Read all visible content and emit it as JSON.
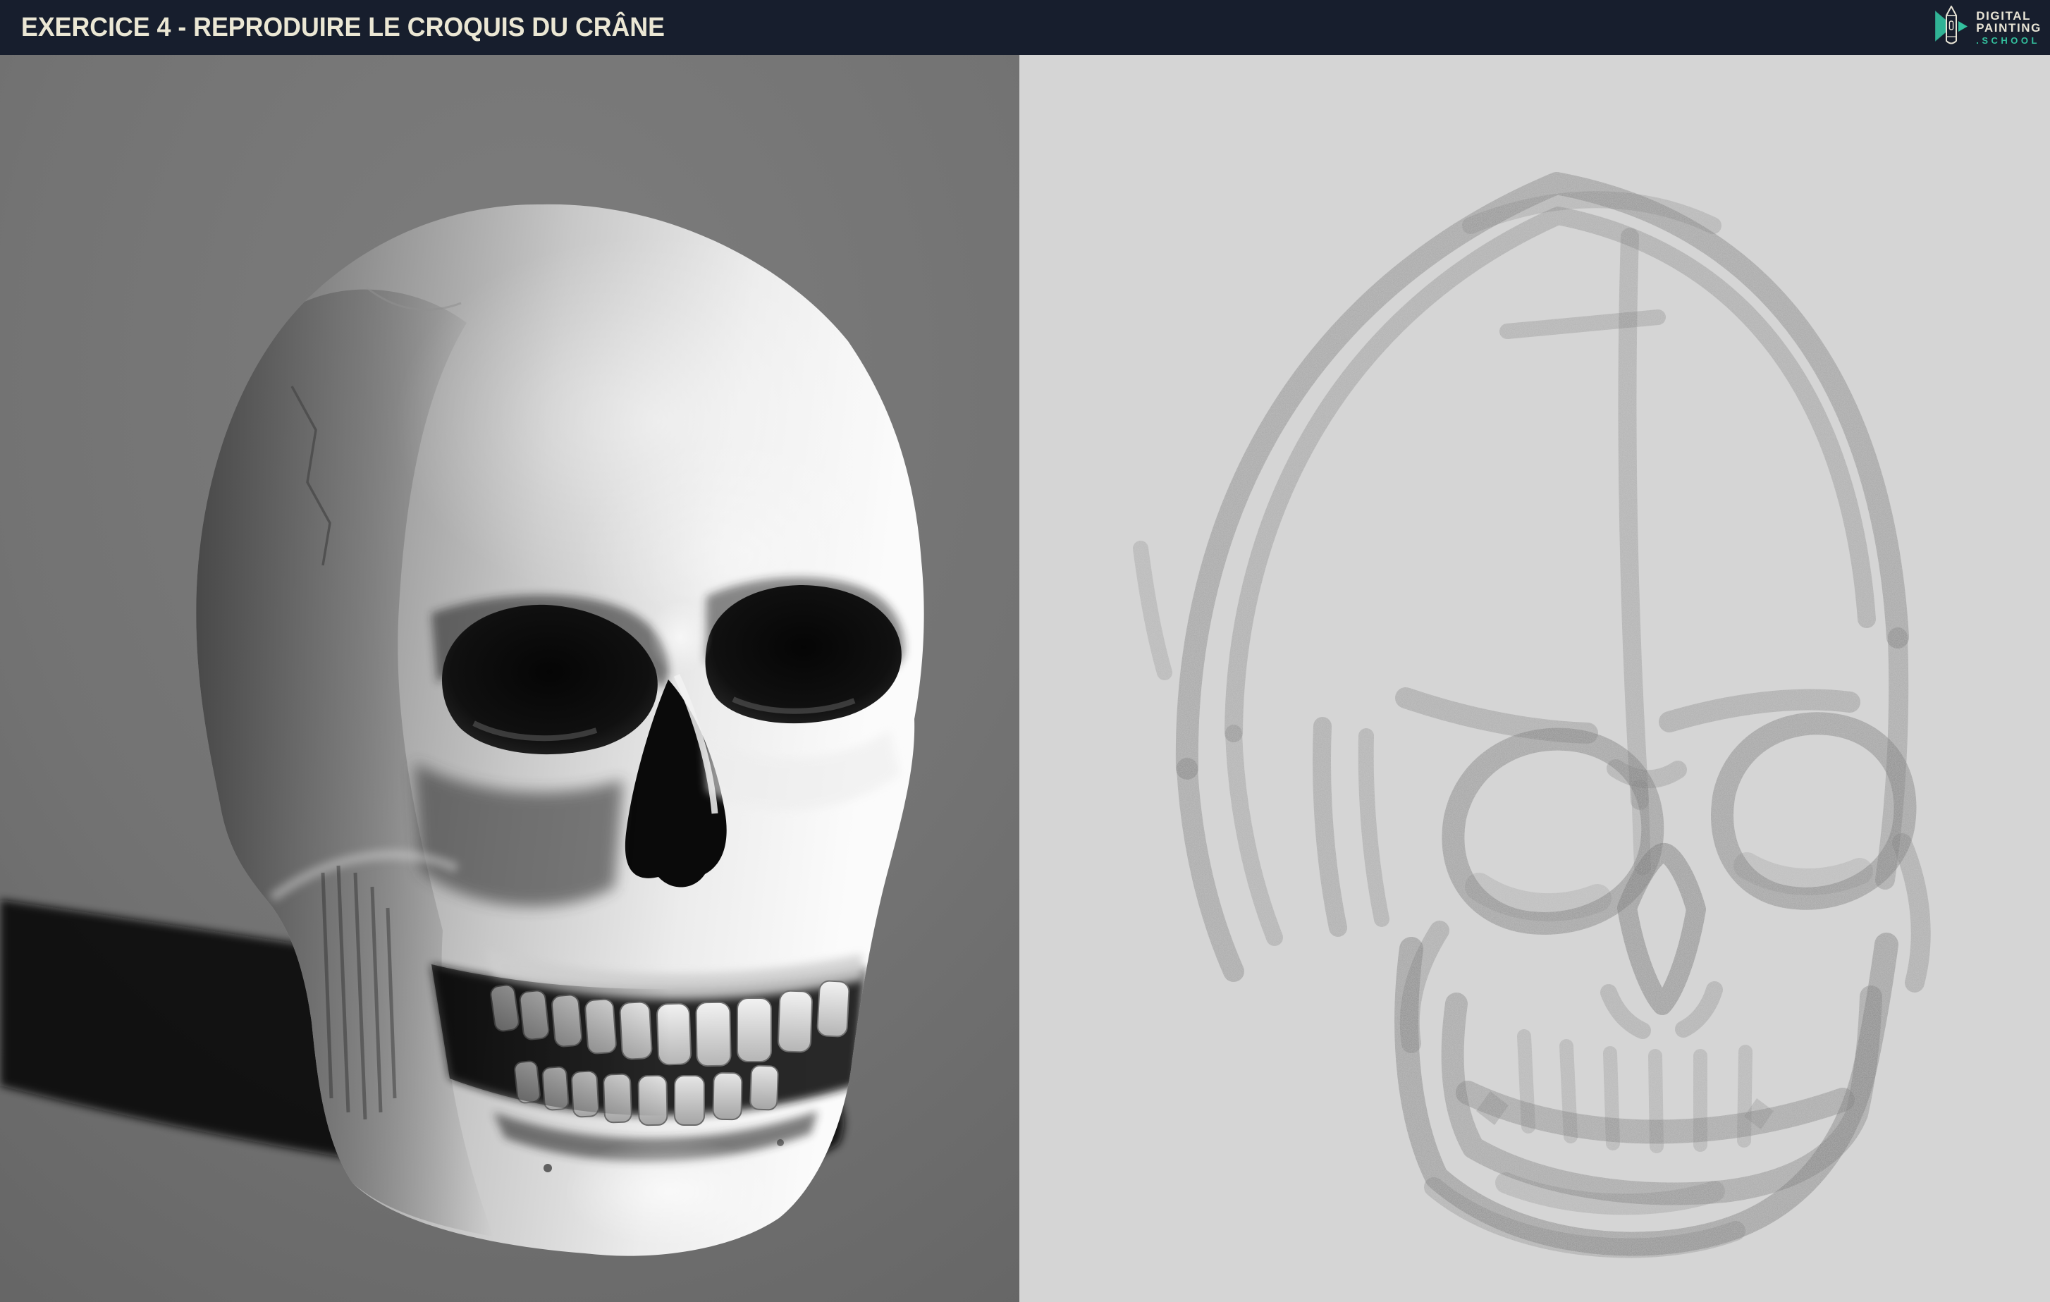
{
  "header": {
    "title": "EXERCICE 4 - REPRODUIRE LE CROQUIS DU CRÂNE",
    "logo": {
      "line1": "DIGITAL",
      "line2": "PAINTING",
      "line3": ".SCHOOL"
    }
  },
  "colors": {
    "header_bg": "#171e2d",
    "header_title_text": "#ebe7d4",
    "logo_text": "#e9e5d6",
    "logo_accent_teal": "#33c09e",
    "render_background": "#747474",
    "render_cast_shadow": "#0d0d0d",
    "skull_bone_light": "#f7f7f7",
    "skull_bone_shadow": "#5f5f5f",
    "sketch_background": "#d5d5d5",
    "sketch_stroke": "#757575"
  },
  "panels": {
    "left": {
      "content": "3d-skull-render"
    },
    "right": {
      "content": "skull-construction-sketch"
    }
  }
}
